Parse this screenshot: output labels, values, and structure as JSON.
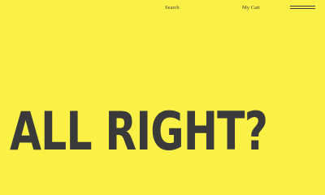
{
  "header": {
    "search_label": "Search",
    "cart_label": "My Cart",
    "menu_icon": "hamburger-menu-icon"
  },
  "hero": {
    "headline": "ALL RIGHT?"
  },
  "colors": {
    "background": "#fbf046",
    "text": "#3a3a3a"
  }
}
